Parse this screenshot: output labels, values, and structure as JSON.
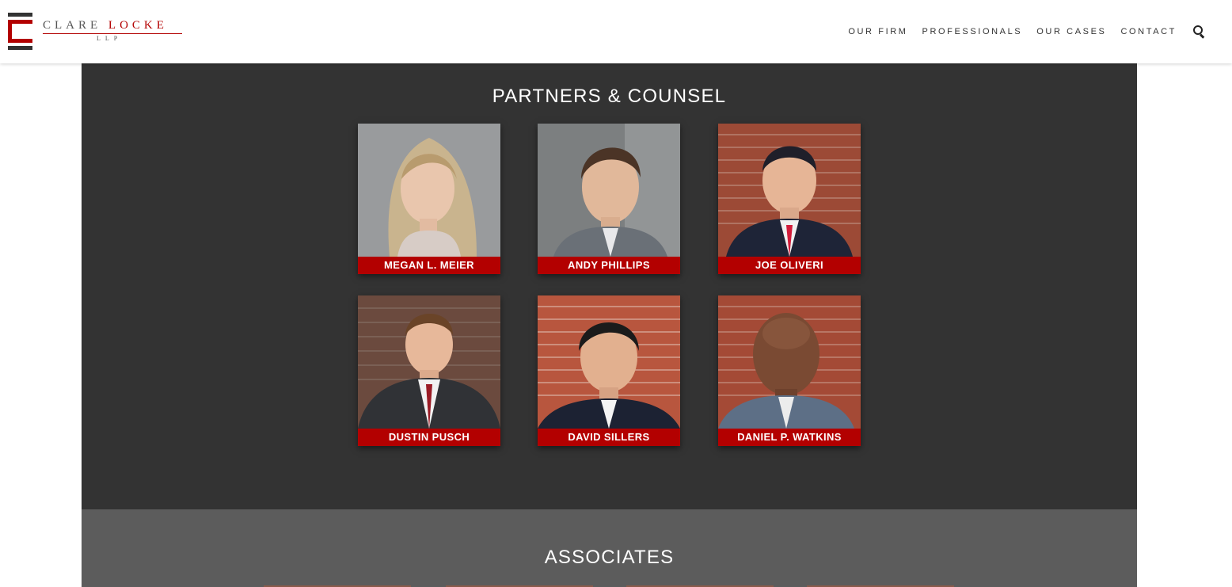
{
  "brand": {
    "name_first": "CLARE",
    "name_second": "LOCKE",
    "suffix": "LLP",
    "accent_color": "#b30000"
  },
  "nav": {
    "items": [
      {
        "label": "OUR FIRM"
      },
      {
        "label": "PROFESSIONALS"
      },
      {
        "label": "OUR CASES"
      },
      {
        "label": "CONTACT"
      }
    ],
    "search_icon": "search-icon"
  },
  "partners": {
    "title": "PARTNERS & COUNSEL",
    "people": [
      {
        "name": "MEGAN L. MEIER",
        "photo": "portrait-gray-background"
      },
      {
        "name": "ANDY PHILLIPS",
        "photo": "portrait-gray-background"
      },
      {
        "name": "JOE OLIVERI",
        "photo": "portrait-brick-background"
      },
      {
        "name": "DUSTIN PUSCH",
        "photo": "portrait-brick-background"
      },
      {
        "name": "DAVID SILLERS",
        "photo": "portrait-brick-background"
      },
      {
        "name": "DANIEL P. WATKINS",
        "photo": "portrait-brick-background"
      }
    ]
  },
  "associates": {
    "title": "ASSOCIATES"
  },
  "colors": {
    "partners_bg": "#333333",
    "associates_bg": "#5c5c5c",
    "nameplate": "#b30000"
  }
}
